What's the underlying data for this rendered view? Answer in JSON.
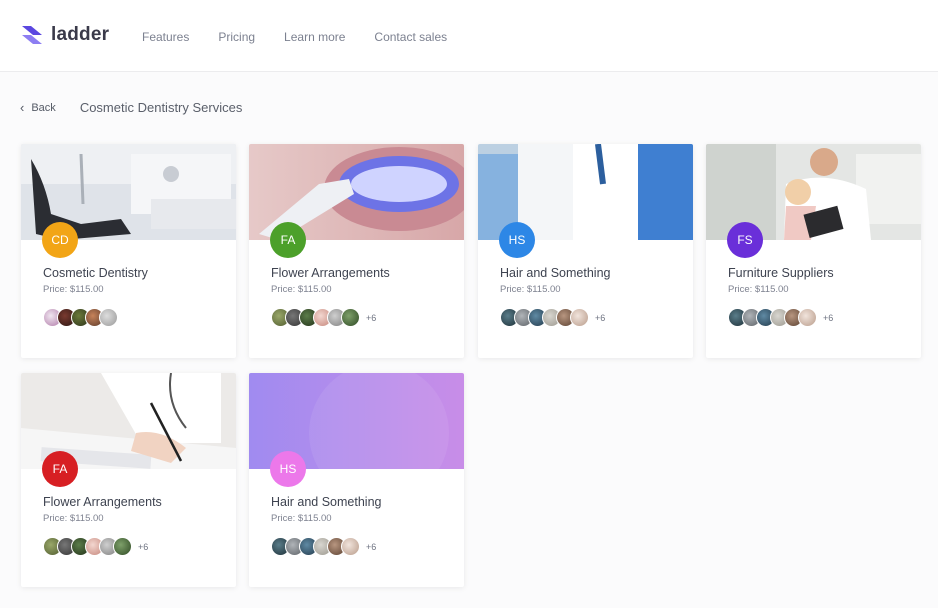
{
  "brand": {
    "name": "ladder",
    "accent": "#5b47e0"
  },
  "nav": [
    {
      "label": "Features"
    },
    {
      "label": "Pricing"
    },
    {
      "label": "Learn more"
    },
    {
      "label": "Contact sales"
    }
  ],
  "subheader": {
    "back_label": "Back",
    "back_icon": "chevron-left-icon",
    "title": "Cosmetic Dentistry Services"
  },
  "cards": [
    {
      "initials": "CD",
      "title": "Cosmetic Dentistry",
      "price": "Price: $115.00",
      "badge_color": "#f2a516",
      "more": "",
      "image": "dental-office-chair"
    },
    {
      "initials": "FA",
      "title": "Flower Arrangements",
      "price": "Price: $115.00",
      "badge_color": "#4ca02a",
      "more": "+6",
      "image": "teeth-whitening"
    },
    {
      "initials": "HS",
      "title": "Hair and Something",
      "price": "Price: $115.00",
      "badge_color": "#2d87e6",
      "more": "+6",
      "image": "medical-team"
    },
    {
      "initials": "FS",
      "title": "Furniture Suppliers",
      "price": "Price: $115.00",
      "badge_color": "#6a2fd9",
      "more": "+6",
      "image": "doctor-with-child"
    },
    {
      "initials": "FA",
      "title": "Flower Arrangements",
      "price": "Price: $115.00",
      "badge_color": "#d71f23",
      "more": "+6",
      "image": "doctor-writing"
    },
    {
      "initials": "HS",
      "title": "Hair and Something",
      "price": "Price: $115.00",
      "badge_color": "#ec78ea",
      "more": "+6",
      "image": "purple-gradient"
    }
  ]
}
